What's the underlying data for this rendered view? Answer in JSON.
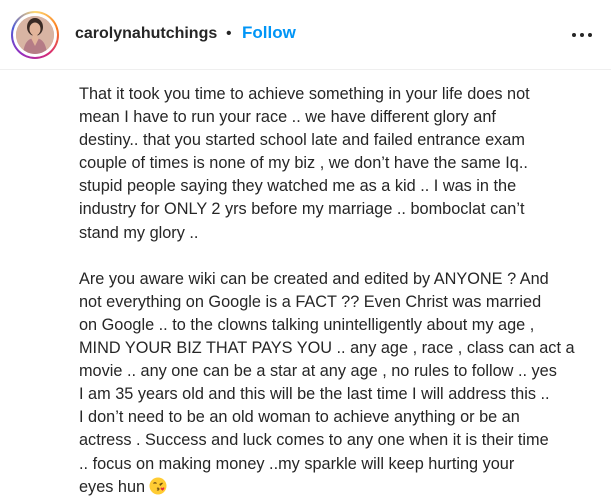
{
  "post": {
    "username": "carolynahutchings",
    "separator": "•",
    "follow_label": "Follow",
    "more_icon": "more-options-icon"
  },
  "caption": {
    "lines": [
      "That it took you time to achieve something in your life does not",
      "mean I have to run your race .. we have different glory anf",
      "destiny.. that you started school late and failed entrance exam",
      "couple of times is none of my biz , we don’t have the same Iq..",
      "stupid people saying they watched me as a kid .. I was in the",
      "industry for ONLY 2 yrs before my marriage .. bomboclat can’t",
      "stand my glory ..",
      "",
      "Are you aware wiki can be created and edited by ANYONE ? And",
      "not everything on Google is a FACT ?? Even Christ was married",
      "on Google .. to the clowns talking unintelligently about my age ,",
      "MIND YOUR BIZ THAT PAYS YOU .. any age , race , class can act a",
      "movie .. any one can be a star at any age , no rules to follow .. yes",
      "I am 35 years old and this will be the last time I will address this ..",
      "I don’t need to be an old woman to achieve anything or be an",
      "actress . Success and luck comes to any one when it is their time",
      ".. focus on making money ..my sparkle will keep hurting your",
      "eyes hun"
    ],
    "end_emoji": "face-blowing-kiss-emoji"
  }
}
